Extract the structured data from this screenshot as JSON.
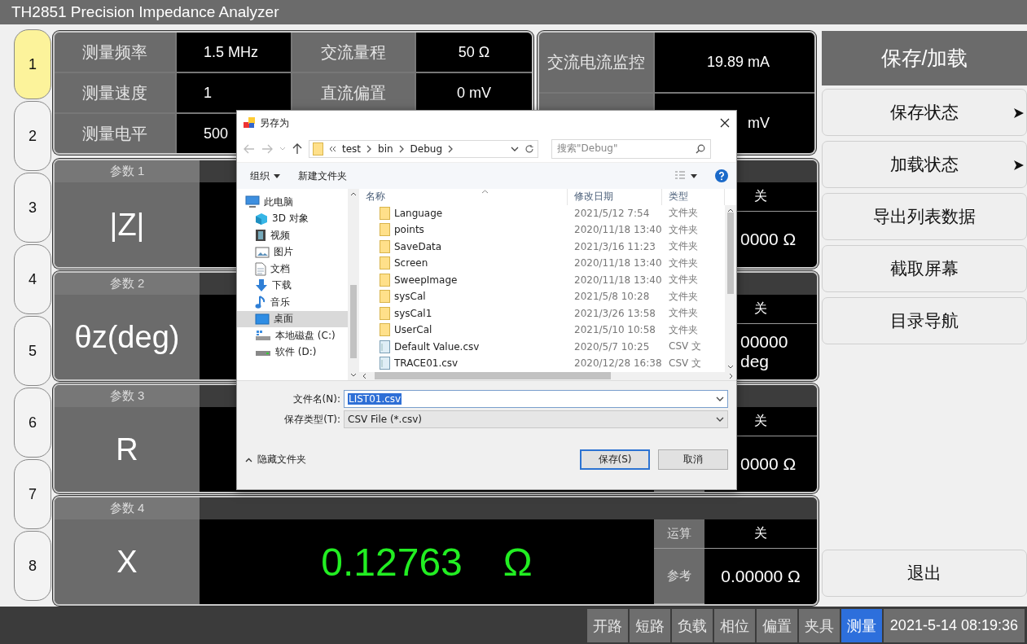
{
  "window": {
    "title": "TH2851 Precision Impedance Analyzer"
  },
  "side_tabs": [
    {
      "label": "1",
      "selected": true
    },
    {
      "label": "2",
      "selected": false
    },
    {
      "label": "3",
      "selected": false
    },
    {
      "label": "4",
      "selected": false
    },
    {
      "label": "5",
      "selected": false
    },
    {
      "label": "6",
      "selected": false
    },
    {
      "label": "7",
      "selected": false
    },
    {
      "label": "8",
      "selected": false
    }
  ],
  "settings": [
    {
      "label": "测量频率",
      "value": "1.5 MHz"
    },
    {
      "label": "交流量程",
      "value": "50 Ω"
    },
    {
      "label": "测量速度",
      "value": "1"
    },
    {
      "label": "直流偏置",
      "value": "0 mV"
    },
    {
      "label": "测量电平",
      "value": "500"
    }
  ],
  "monitor": [
    {
      "label": "交流电流监控",
      "value": "19.89 mA"
    },
    {
      "value": "mV"
    }
  ],
  "params": [
    {
      "header": "参数 1",
      "name": "|Z|",
      "op_value": "关",
      "ref_value": "0000 Ω"
    },
    {
      "header": "参数 2",
      "name": "θz(deg)",
      "op_value": "关",
      "ref_value": "00000 deg"
    },
    {
      "header": "参数 3",
      "name": "R",
      "op_value": "关",
      "ref_value": "0000 Ω"
    },
    {
      "header": "参数 4",
      "name": "X",
      "reading": "0.12763",
      "unit": "Ω",
      "op_label": "运算",
      "op_value": "关",
      "ref_label": "参考",
      "ref_value": "0.00000 Ω"
    }
  ],
  "menu": {
    "title": "保存/加载",
    "items": [
      {
        "label": "保存状态",
        "submenu": true
      },
      {
        "label": "加载状态",
        "submenu": true
      },
      {
        "label": "导出列表数据",
        "submenu": false
      },
      {
        "label": "截取屏幕",
        "submenu": false
      },
      {
        "label": "目录导航",
        "submenu": false
      }
    ],
    "bottom_item": {
      "label": "退出"
    }
  },
  "status_bar": {
    "items": [
      {
        "label": "开路",
        "selected": false
      },
      {
        "label": "短路",
        "selected": false
      },
      {
        "label": "负载",
        "selected": false
      },
      {
        "label": "相位",
        "selected": false
      },
      {
        "label": "偏置",
        "selected": false
      },
      {
        "label": "夹具",
        "selected": false
      },
      {
        "label": "测量",
        "selected": true
      }
    ],
    "datetime": "2021-5-14 08:19:36"
  },
  "dialog": {
    "title": "另存为",
    "path": [
      "test",
      "bin",
      "Debug"
    ],
    "search": {
      "placeholder": "搜索\"Debug\""
    },
    "toolbar": {
      "organize": "组织",
      "new_folder": "新建文件夹"
    },
    "nav": [
      {
        "label": "此电脑",
        "kind": "pc",
        "selected": false,
        "children": [
          {
            "label": "3D 对象",
            "kind": "cube",
            "selected": false
          },
          {
            "label": "视频",
            "kind": "video",
            "selected": false
          },
          {
            "label": "图片",
            "kind": "picture",
            "selected": false
          },
          {
            "label": "文档",
            "kind": "document",
            "selected": false
          },
          {
            "label": "下载",
            "kind": "download",
            "selected": false
          },
          {
            "label": "音乐",
            "kind": "music",
            "selected": false
          },
          {
            "label": "桌面",
            "kind": "desktop",
            "selected": true
          },
          {
            "label": "本地磁盘 (C:)",
            "kind": "system-drive",
            "selected": false
          },
          {
            "label": "软件 (D:)",
            "kind": "drive",
            "selected": false
          }
        ]
      }
    ],
    "columns": [
      "名称",
      "修改日期",
      "类型"
    ],
    "files": [
      {
        "name": "Language",
        "date": "2021/5/12 7:54",
        "type": "文件夹",
        "kind": "folder"
      },
      {
        "name": "points",
        "date": "2020/11/18 13:40",
        "type": "文件夹",
        "kind": "folder"
      },
      {
        "name": "SaveData",
        "date": "2021/3/16 11:23",
        "type": "文件夹",
        "kind": "folder"
      },
      {
        "name": "Screen",
        "date": "2020/11/18 13:40",
        "type": "文件夹",
        "kind": "folder"
      },
      {
        "name": "SweepImage",
        "date": "2020/11/18 13:40",
        "type": "文件夹",
        "kind": "folder"
      },
      {
        "name": "sysCal",
        "date": "2021/5/8 10:28",
        "type": "文件夹",
        "kind": "folder"
      },
      {
        "name": "sysCal1",
        "date": "2021/3/26 13:58",
        "type": "文件夹",
        "kind": "folder"
      },
      {
        "name": "UserCal",
        "date": "2021/5/10 10:58",
        "type": "文件夹",
        "kind": "folder"
      },
      {
        "name": "Default Value.csv",
        "date": "2020/5/7 10:25",
        "type": "CSV 文",
        "kind": "file"
      },
      {
        "name": "TRACE01.csv",
        "date": "2020/12/28 16:38",
        "type": "CSV 文",
        "kind": "file"
      }
    ],
    "filename": {
      "label": "文件名(N):",
      "value": "LIST01.csv"
    },
    "filetype": {
      "label": "保存类型(T):",
      "value": "CSV File (*.csv)"
    },
    "hide_folders": "隐藏文件夹",
    "buttons": [
      {
        "label": "保存(S)",
        "default": true
      },
      {
        "label": "取消",
        "default": false
      }
    ]
  }
}
